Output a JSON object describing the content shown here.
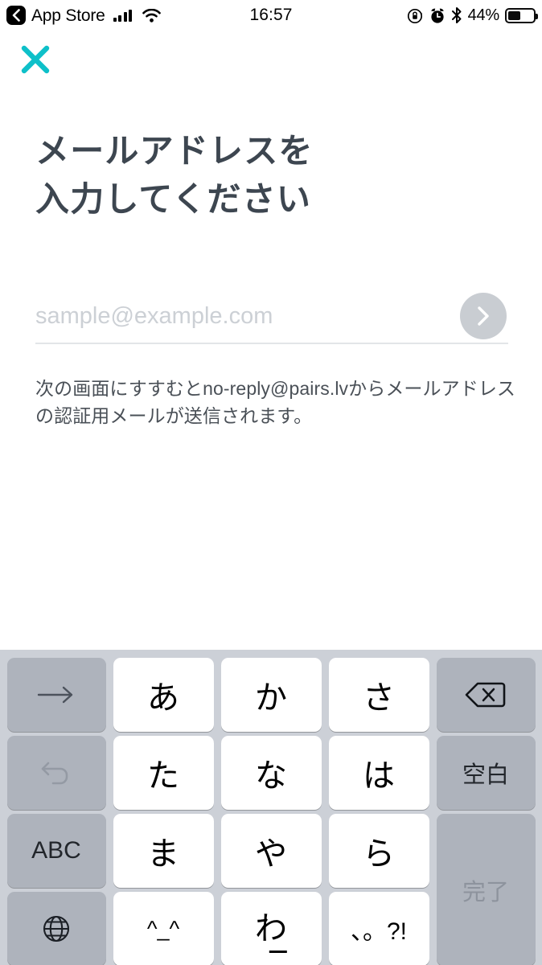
{
  "status_bar": {
    "back_label": "App Store",
    "back_icon": "chevron-left-icon",
    "signal_icon": "cellular-signal-icon",
    "wifi_icon": "wifi-icon",
    "time": "16:57",
    "rotation_lock_icon": "rotation-lock-icon",
    "alarm_icon": "alarm-clock-icon",
    "bluetooth_icon": "bluetooth-icon",
    "battery_percent": "44%",
    "battery_level": 44
  },
  "close_button": {
    "icon": "close-x-icon",
    "color": "#0ec0c9"
  },
  "main": {
    "title": "メールアドレスを\n入力してください",
    "title_color": "#3d4650",
    "email": {
      "value": "",
      "placeholder": "sample@example.com",
      "submit_icon": "chevron-right-icon",
      "submit_bg": "#c9cdd2"
    },
    "description": "次の画面にすすむとno-reply@pairs.lvからメールアドレスの認証用メールが送信されます。"
  },
  "keyboard": {
    "background": "#ccd0d7",
    "key_bg": "#ffffff",
    "fn_key_bg": "#aeb3bc",
    "left_column": [
      {
        "label": "→",
        "name": "key-next-candidate",
        "icon": "arrow-right-icon",
        "dim": false
      },
      {
        "label": "↺",
        "name": "key-undo",
        "icon": "undo-arrow-icon",
        "dim": true
      },
      {
        "label": "ABC",
        "name": "key-abc-mode",
        "icon": "",
        "dim": false
      },
      {
        "label": "🌐",
        "name": "key-globe-language",
        "icon": "globe-icon",
        "dim": false
      }
    ],
    "center_rows": [
      [
        {
          "label": "あ",
          "name": "key-a-row"
        },
        {
          "label": "か",
          "name": "key-ka-row"
        },
        {
          "label": "さ",
          "name": "key-sa-row"
        }
      ],
      [
        {
          "label": "た",
          "name": "key-ta-row"
        },
        {
          "label": "な",
          "name": "key-na-row"
        },
        {
          "label": "は",
          "name": "key-ha-row"
        }
      ],
      [
        {
          "label": "ま",
          "name": "key-ma-row"
        },
        {
          "label": "や",
          "name": "key-ya-row"
        },
        {
          "label": "ら",
          "name": "key-ra-row"
        }
      ],
      [
        {
          "label": "^_^",
          "name": "key-emoticon"
        },
        {
          "label": "わ",
          "name": "key-wa-row"
        },
        {
          "label": "、。?!",
          "name": "key-punctuation"
        }
      ]
    ],
    "right_column": [
      {
        "label": "⌫",
        "name": "key-backspace",
        "icon": "backspace-icon",
        "dim": false
      },
      {
        "label": "空白",
        "name": "key-space",
        "icon": "",
        "dim": false
      },
      {
        "label": "完了",
        "name": "key-done",
        "icon": "",
        "dim": true
      }
    ]
  }
}
